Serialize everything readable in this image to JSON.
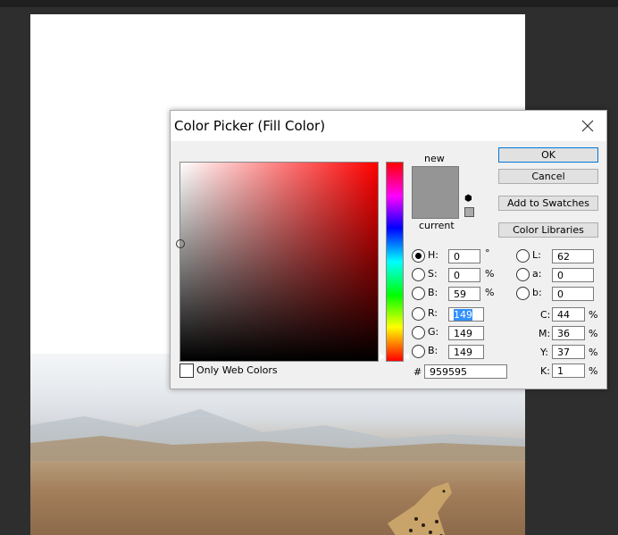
{
  "dialog": {
    "title": "Color Picker (Fill Color)",
    "new_label": "new",
    "current_label": "current",
    "buttons": {
      "ok": "OK",
      "cancel": "Cancel",
      "add_to_swatches": "Add to Swatches",
      "color_libraries": "Color Libraries"
    },
    "hsb": {
      "h_label": "H:",
      "h_value": "0",
      "h_unit": "°",
      "s_label": "S:",
      "s_value": "0",
      "s_unit": "%",
      "b_label": "B:",
      "b_value": "59",
      "b_unit": "%"
    },
    "rgb": {
      "r_label": "R:",
      "r_value": "149",
      "g_label": "G:",
      "g_value": "149",
      "b_label": "B:",
      "b_value": "149"
    },
    "lab": {
      "l_label": "L:",
      "l_value": "62",
      "a_label": "a:",
      "a_value": "0",
      "b_label": "b:",
      "b_value": "0"
    },
    "cmyk": {
      "c_label": "C:",
      "c_value": "44",
      "c_unit": "%",
      "m_label": "M:",
      "m_value": "36",
      "m_unit": "%",
      "y_label": "Y:",
      "y_value": "37",
      "y_unit": "%",
      "k_label": "K:",
      "k_value": "1",
      "k_unit": "%"
    },
    "hex_label": "#",
    "hex_value": "959595",
    "only_web_colors": "Only Web Colors",
    "selected_radio": "H",
    "colors": {
      "current_color": "#959595",
      "ok_border": "#0078d7",
      "selection_highlight": "#3390ff"
    }
  }
}
